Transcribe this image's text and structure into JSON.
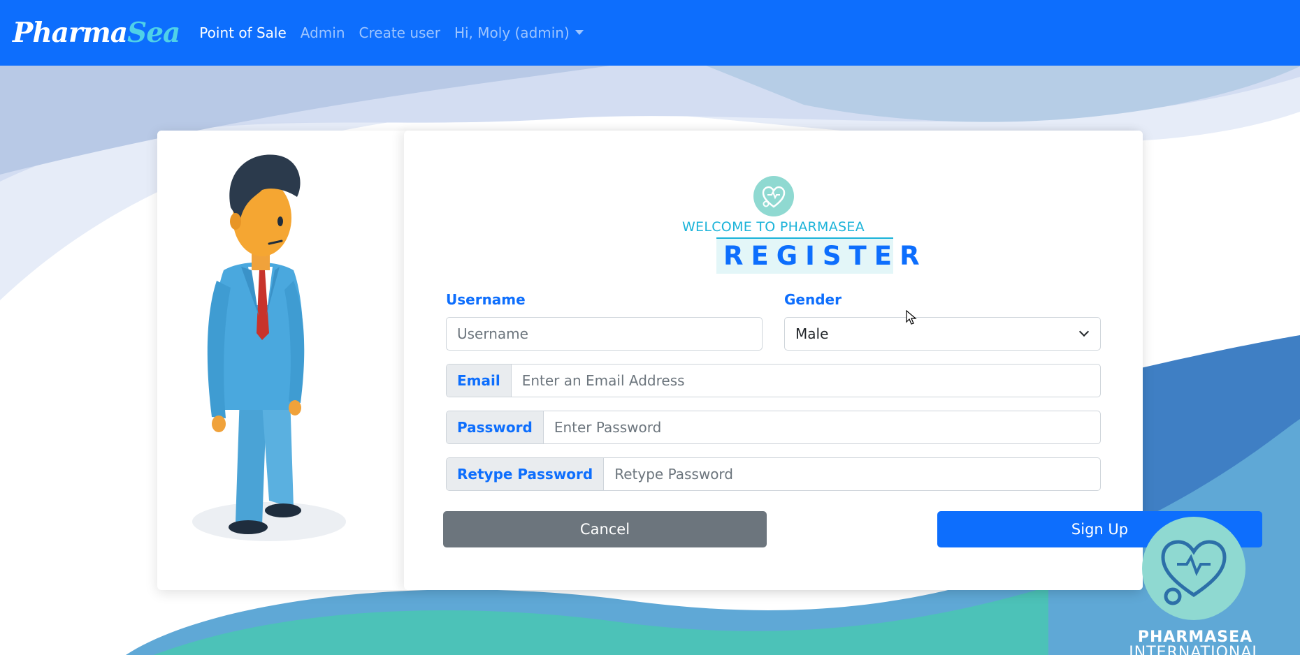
{
  "nav": {
    "brand_part1": "Pharma",
    "brand_part2": "Sea",
    "links": [
      {
        "label": "Point of Sale"
      },
      {
        "label": "Admin"
      },
      {
        "label": "Create user"
      }
    ],
    "user_menu": "Hi, Moly (admin)"
  },
  "form": {
    "welcome": "WELCOME TO PHARMASEA",
    "title": "REGISTER",
    "username_label": "Username",
    "username_placeholder": "Username",
    "gender_label": "Gender",
    "gender_value": "Male",
    "email_label": "Email",
    "email_placeholder": "Enter an Email Address",
    "password_label": "Password",
    "password_placeholder": "Enter Password",
    "retype_label": "Retype Password",
    "retype_placeholder": "Retype Password",
    "cancel_label": "Cancel",
    "signup_label": "Sign Up"
  },
  "corner": {
    "line1": "PHARMASEA",
    "line2": "INTERNATIONAL"
  },
  "colors": {
    "primary": "#0d6efd",
    "secondary": "#6c757d",
    "teal": "#8fd9d1",
    "accent": "#1bb3d9"
  }
}
